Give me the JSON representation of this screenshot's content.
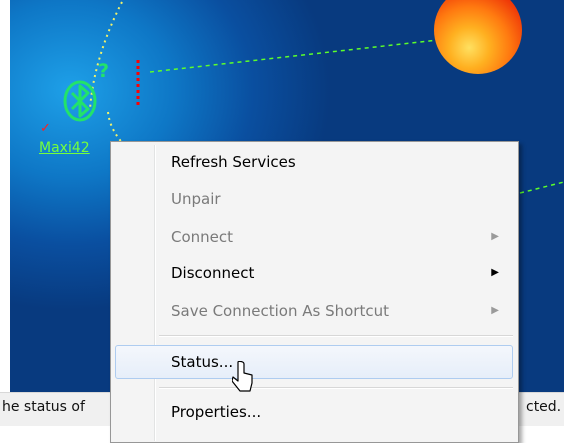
{
  "canvas": {
    "device_label": "Maxi42",
    "question_mark": "?",
    "check_mark": "✓",
    "colors": {
      "background": "#0a4fa0",
      "device": "#22e36a",
      "link_line": "#5cff2a",
      "signal": "#ff0000",
      "sphere": "#ff7a10"
    }
  },
  "context_menu": {
    "items": [
      {
        "label": "Refresh Services",
        "enabled": true,
        "submenu": false
      },
      {
        "label": "Unpair",
        "enabled": false,
        "submenu": false
      },
      {
        "label": "Connect",
        "enabled": false,
        "submenu": true
      },
      {
        "label": "Disconnect",
        "enabled": true,
        "submenu": true
      },
      {
        "label": "Save Connection As Shortcut",
        "enabled": false,
        "submenu": true
      },
      {
        "label": "Status...",
        "enabled": true,
        "submenu": false,
        "highlighted": true
      },
      {
        "label": "Properties...",
        "enabled": true,
        "submenu": false
      }
    ],
    "submenu_arrow": "▶"
  },
  "statusbar": {
    "left_text": "he status of",
    "right_text": "cted."
  },
  "icons": {
    "device": "bluetooth-device-icon",
    "cursor": "mouse-pointer-icon"
  }
}
